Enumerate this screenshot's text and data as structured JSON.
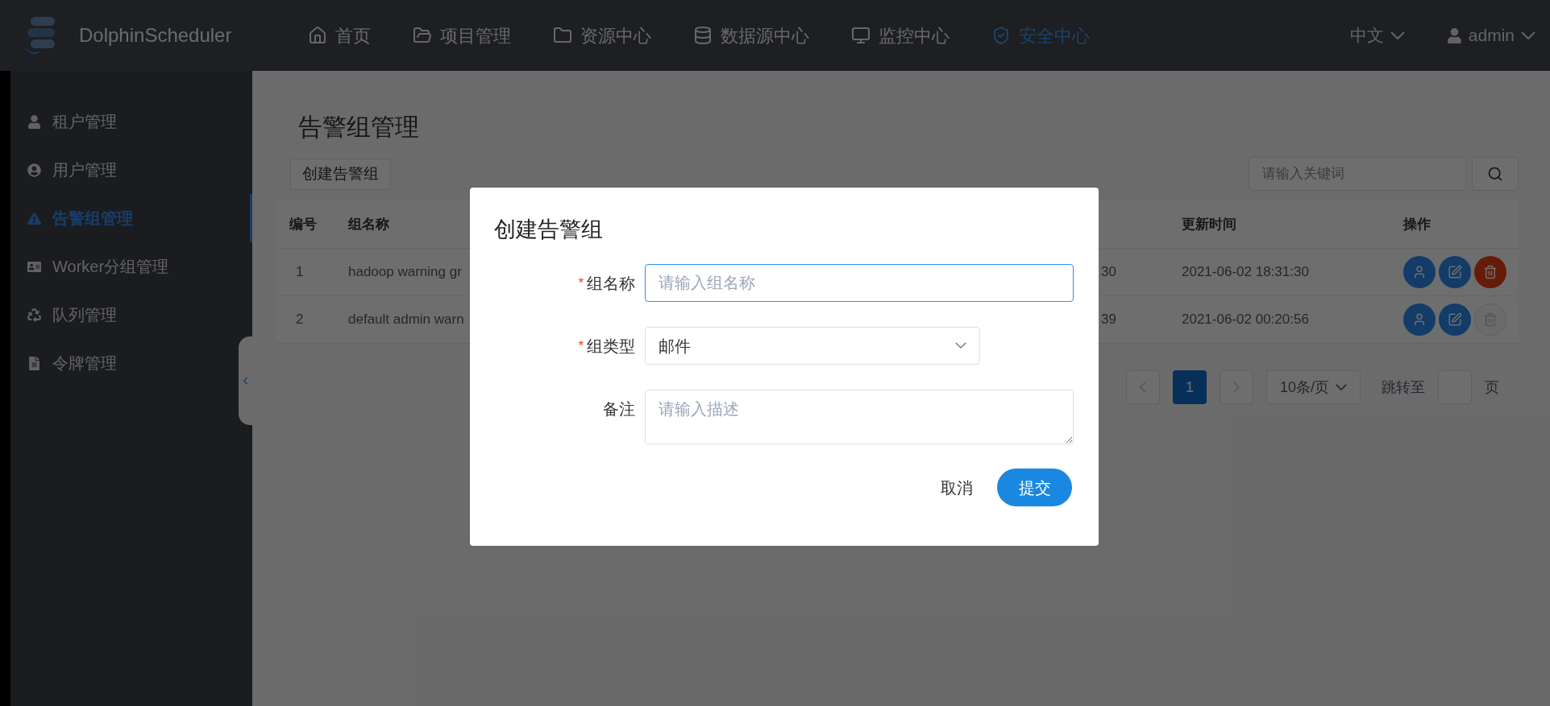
{
  "header": {
    "logo": "DolphinScheduler",
    "nav": [
      {
        "label": "首页",
        "selected": false
      },
      {
        "label": "项目管理",
        "selected": false
      },
      {
        "label": "资源中心",
        "selected": false
      },
      {
        "label": "数据源中心",
        "selected": false
      },
      {
        "label": "监控中心",
        "selected": false
      },
      {
        "label": "安全中心",
        "selected": true
      }
    ],
    "language": "中文",
    "user": "admin"
  },
  "sidebar": {
    "items": [
      {
        "label": "租户管理",
        "selected": false
      },
      {
        "label": "用户管理",
        "selected": false
      },
      {
        "label": "告警组管理",
        "selected": true
      },
      {
        "label": "Worker分组管理",
        "selected": false
      },
      {
        "label": "队列管理",
        "selected": false
      },
      {
        "label": "令牌管理",
        "selected": false
      }
    ]
  },
  "page": {
    "title": "告警组管理",
    "create_button": "创建告警组",
    "search": {
      "placeholder": "请输入关键词"
    }
  },
  "table": {
    "columns": [
      "编号",
      "组名称",
      "更新时间",
      "操作"
    ],
    "rows": [
      {
        "number": "1",
        "name": "hadoop warning gr",
        "column_3": "30",
        "updated": "2021-06-02 18:31:30",
        "delete_disabled": false
      },
      {
        "number": "2",
        "name": "default admin warn",
        "column_3": "39",
        "updated": "2021-06-02 00:20:56",
        "delete_disabled": true
      }
    ]
  },
  "pagination": {
    "current": "1",
    "page_size": "10条/页",
    "jump_label": "跳转至",
    "page_suffix": "页"
  },
  "dialog": {
    "title": "创建告警组",
    "fields": [
      {
        "kind": "input",
        "required_mark": "*",
        "label": "组名称",
        "placeholder": "请输入组名称"
      },
      {
        "kind": "select",
        "required_mark": "*",
        "label": "组类型",
        "value": "邮件"
      },
      {
        "kind": "textarea",
        "label": "备注",
        "placeholder": "请输入描述"
      }
    ],
    "buttons": [
      {
        "kind": "text",
        "label": "取消"
      },
      {
        "kind": "primary",
        "label": "提交"
      }
    ]
  }
}
